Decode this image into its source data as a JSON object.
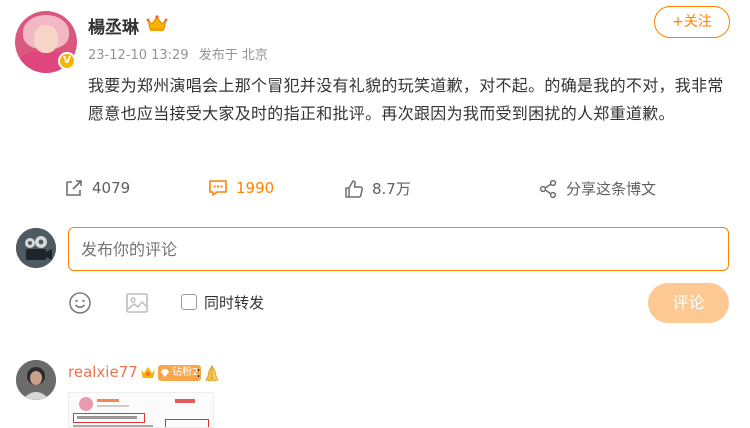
{
  "post": {
    "username": "楊丞琳",
    "time": "23-12-10 13:29",
    "source": "发布于 北京",
    "follow_label": "+关注",
    "text": "我要为郑州演唱会上那个冒犯并没有礼貌的玩笑道歉，对不起。的确是我的不对，我非常愿意也应当接受大家及时的指正和批评。再次跟因为我而受到困扰的人郑重道歉。"
  },
  "actions": {
    "repost_count": "4079",
    "comment_count": "1990",
    "like_count": "8.7万",
    "share_label": "分享这条博文"
  },
  "composer": {
    "placeholder": "发布你的评论",
    "repost_label": "同时转发",
    "submit_label": "评论"
  },
  "comment": {
    "username": "realxie77",
    "badge_label": "钻粉2",
    "separator": ":"
  },
  "colors": {
    "accent": "#ff8200",
    "link": "#eb7350",
    "submit_disabled": "#fdc892"
  }
}
